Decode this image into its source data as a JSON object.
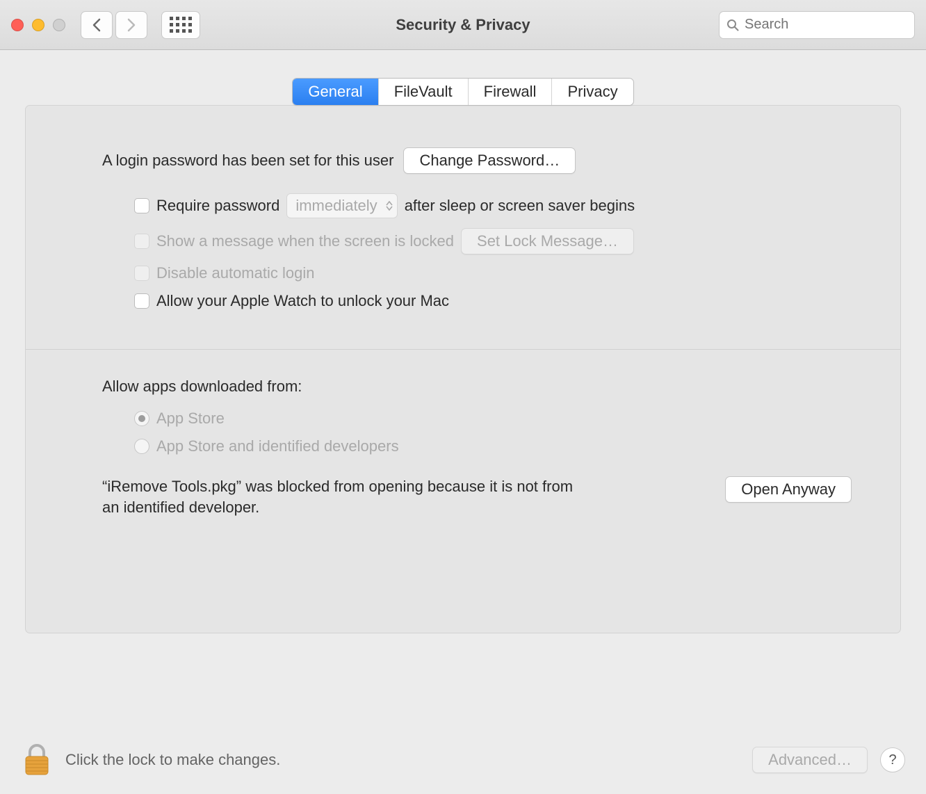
{
  "window": {
    "title": "Security & Privacy",
    "search_placeholder": "Search"
  },
  "tabs": {
    "general": "General",
    "filevault": "FileVault",
    "firewall": "Firewall",
    "privacy": "Privacy"
  },
  "general": {
    "login_password_set_text": "A login password has been set for this user",
    "change_password_btn": "Change Password…",
    "require_password_label": "Require password",
    "require_password_delay": "immediately",
    "require_password_suffix": "after sleep or screen saver begins",
    "show_message_label": "Show a message when the screen is locked",
    "set_lock_message_btn": "Set Lock Message…",
    "disable_auto_login_label": "Disable automatic login",
    "apple_watch_label": "Allow your Apple Watch to unlock your Mac",
    "allow_apps_heading": "Allow apps downloaded from:",
    "radio_app_store": "App Store",
    "radio_identified": "App Store and identified developers",
    "blocked_message": "“iRemove Tools.pkg” was blocked from opening because it is not from an identified developer.",
    "open_anyway_btn": "Open Anyway"
  },
  "footer": {
    "lock_text": "Click the lock to make changes.",
    "advanced_btn": "Advanced…",
    "help": "?"
  }
}
